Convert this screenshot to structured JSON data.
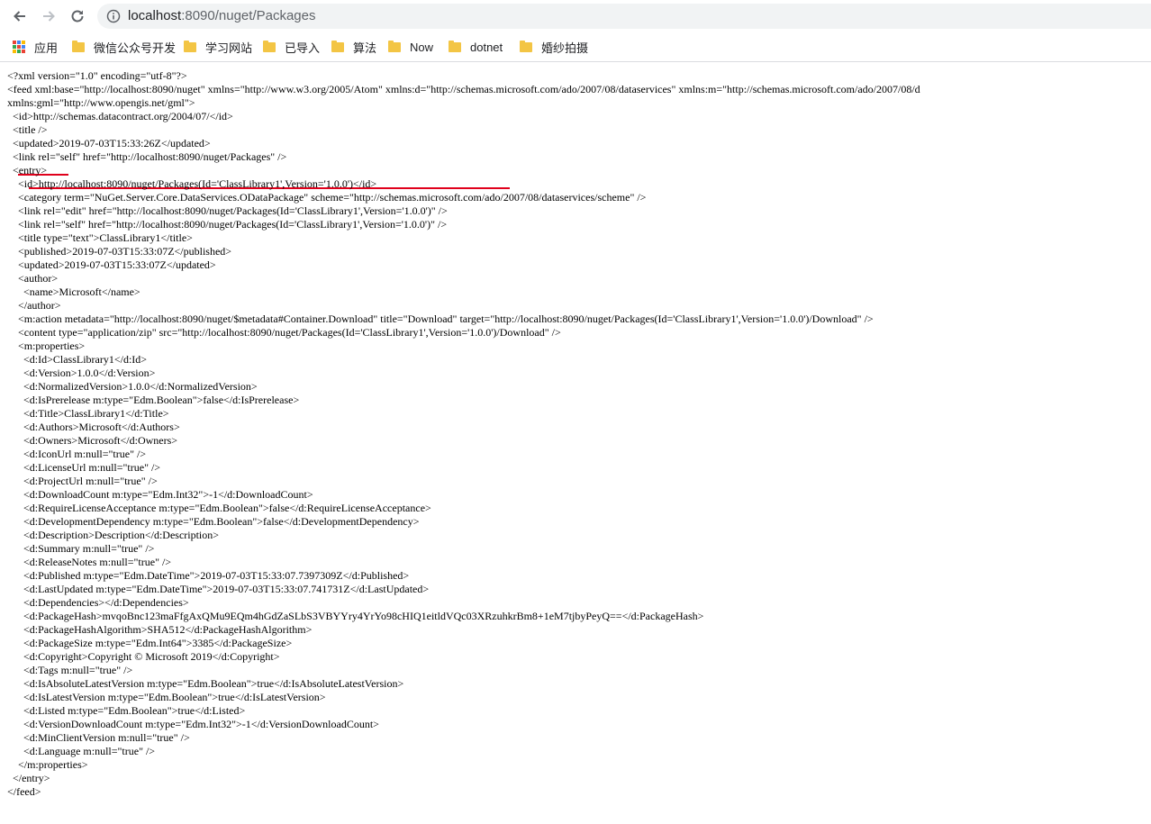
{
  "browser": {
    "url_host": "localhost",
    "url_rest": ":8090/nuget/Packages",
    "bookmarks": [
      "应用",
      "微信公众号开发",
      "学习网站",
      "已导入",
      "算法",
      "Now",
      "dotnet",
      "婚纱拍摄"
    ]
  },
  "colors": {
    "annotation_underline": "#e0001b",
    "folder": "#f3c544"
  },
  "xml_lines": [
    "<?xml version=\"1.0\" encoding=\"utf-8\"?>",
    "<feed xml:base=\"http://localhost:8090/nuget\" xmlns=\"http://www.w3.org/2005/Atom\" xmlns:d=\"http://schemas.microsoft.com/ado/2007/08/dataservices\" xmlns:m=\"http://schemas.microsoft.com/ado/2007/08/d",
    "xmlns:gml=\"http://www.opengis.net/gml\">",
    "  <id>http://schemas.datacontract.org/2004/07/</id>",
    "  <title />",
    "  <updated>2019-07-03T15:33:26Z</updated>",
    "  <link rel=\"self\" href=\"http://localhost:8090/nuget/Packages\" />",
    "  <entry>",
    "    <id>http://localhost:8090/nuget/Packages(Id='ClassLibrary1',Version='1.0.0')</id>",
    "    <category term=\"NuGet.Server.Core.DataServices.ODataPackage\" scheme=\"http://schemas.microsoft.com/ado/2007/08/dataservices/scheme\" />",
    "    <link rel=\"edit\" href=\"http://localhost:8090/nuget/Packages(Id='ClassLibrary1',Version='1.0.0')\" />",
    "    <link rel=\"self\" href=\"http://localhost:8090/nuget/Packages(Id='ClassLibrary1',Version='1.0.0')\" />",
    "    <title type=\"text\">ClassLibrary1</title>",
    "    <published>2019-07-03T15:33:07Z</published>",
    "    <updated>2019-07-03T15:33:07Z</updated>",
    "    <author>",
    "      <name>Microsoft</name>",
    "    </author>",
    "    <m:action metadata=\"http://localhost:8090/nuget/$metadata#Container.Download\" title=\"Download\" target=\"http://localhost:8090/nuget/Packages(Id='ClassLibrary1',Version='1.0.0')/Download\" />",
    "    <content type=\"application/zip\" src=\"http://localhost:8090/nuget/Packages(Id='ClassLibrary1',Version='1.0.0')/Download\" />",
    "    <m:properties>",
    "      <d:Id>ClassLibrary1</d:Id>",
    "      <d:Version>1.0.0</d:Version>",
    "      <d:NormalizedVersion>1.0.0</d:NormalizedVersion>",
    "      <d:IsPrerelease m:type=\"Edm.Boolean\">false</d:IsPrerelease>",
    "      <d:Title>ClassLibrary1</d:Title>",
    "      <d:Authors>Microsoft</d:Authors>",
    "      <d:Owners>Microsoft</d:Owners>",
    "      <d:IconUrl m:null=\"true\" />",
    "      <d:LicenseUrl m:null=\"true\" />",
    "      <d:ProjectUrl m:null=\"true\" />",
    "      <d:DownloadCount m:type=\"Edm.Int32\">-1</d:DownloadCount>",
    "      <d:RequireLicenseAcceptance m:type=\"Edm.Boolean\">false</d:RequireLicenseAcceptance>",
    "      <d:DevelopmentDependency m:type=\"Edm.Boolean\">false</d:DevelopmentDependency>",
    "      <d:Description>Description</d:Description>",
    "      <d:Summary m:null=\"true\" />",
    "      <d:ReleaseNotes m:null=\"true\" />",
    "      <d:Published m:type=\"Edm.DateTime\">2019-07-03T15:33:07.7397309Z</d:Published>",
    "      <d:LastUpdated m:type=\"Edm.DateTime\">2019-07-03T15:33:07.741731Z</d:LastUpdated>",
    "      <d:Dependencies></d:Dependencies>",
    "      <d:PackageHash>mvqoBnc123maFfgAxQMu9EQm4hGdZaSLbS3VBYYry4YrYo98cHIQ1eitldVQc03XRzuhkrBm8+1eM7tjbyPeyQ==</d:PackageHash>",
    "      <d:PackageHashAlgorithm>SHA512</d:PackageHashAlgorithm>",
    "      <d:PackageSize m:type=\"Edm.Int64\">3385</d:PackageSize>",
    "      <d:Copyright>Copyright © Microsoft 2019</d:Copyright>",
    "      <d:Tags m:null=\"true\" />",
    "      <d:IsAbsoluteLatestVersion m:type=\"Edm.Boolean\">true</d:IsAbsoluteLatestVersion>",
    "      <d:IsLatestVersion m:type=\"Edm.Boolean\">true</d:IsLatestVersion>",
    "      <d:Listed m:type=\"Edm.Boolean\">true</d:Listed>",
    "      <d:VersionDownloadCount m:type=\"Edm.Int32\">-1</d:VersionDownloadCount>",
    "      <d:MinClientVersion m:null=\"true\" />",
    "      <d:Language m:null=\"true\" />",
    "    </m:properties>",
    "  </entry>",
    "</feed>"
  ]
}
